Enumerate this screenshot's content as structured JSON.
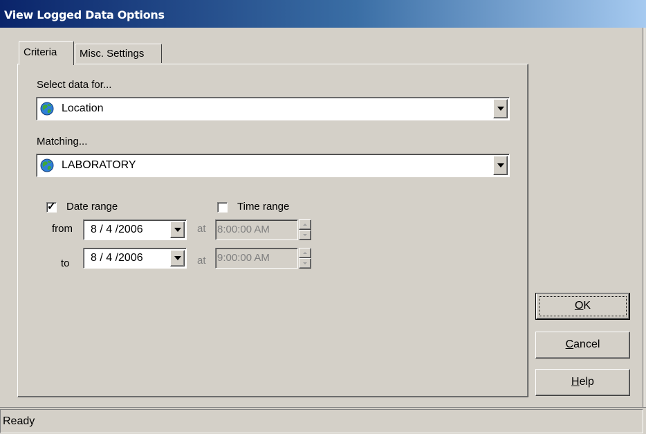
{
  "window": {
    "title": "View Logged Data Options"
  },
  "tabs": [
    {
      "label": "Criteria",
      "active": true
    },
    {
      "label": "Misc. Settings",
      "active": false
    }
  ],
  "criteria": {
    "select_label": "Select data for...",
    "select_value": "Location",
    "select_icon": "globe-icon",
    "matching_label": "Matching...",
    "matching_value": "LABORATORY",
    "matching_icon": "globe-icon",
    "date_range": {
      "label": "Date range",
      "checked": true
    },
    "time_range": {
      "label": "Time range",
      "checked": false
    },
    "from_label": "from",
    "to_label": "to",
    "at_label": "at",
    "from_date": "8 / 4 /2006",
    "to_date": "8 / 4 /2006",
    "from_time": "8:00:00 AM",
    "to_time": "9:00:00 AM"
  },
  "buttons": {
    "ok": {
      "label": "OK",
      "mnemonic": "O",
      "rest": "K"
    },
    "cancel": {
      "label": "Cancel",
      "mnemonic": "C",
      "rest": "ancel"
    },
    "help": {
      "label": "Help",
      "mnemonic": "H",
      "rest": "elp"
    }
  },
  "status": {
    "text": "Ready"
  },
  "colors": {
    "titlebar_start": "#0a246a",
    "titlebar_end": "#a6caf0",
    "face": "#d4d0c8"
  }
}
